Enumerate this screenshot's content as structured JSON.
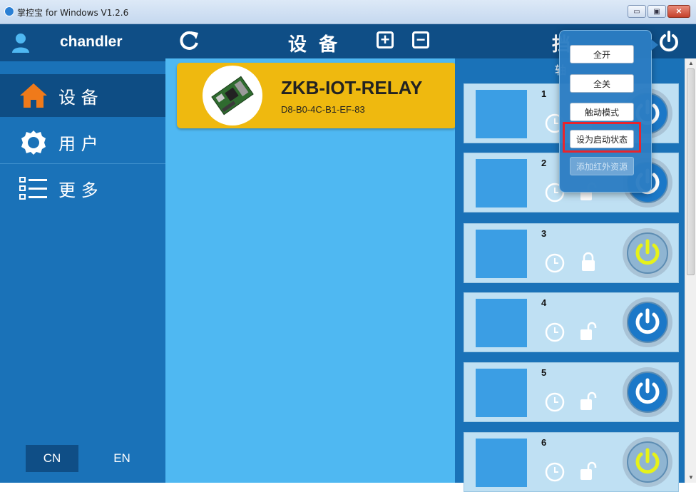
{
  "window": {
    "title": "掌控宝 for Windows V1.2.6",
    "controls": [
      "minimize",
      "maximize",
      "close"
    ],
    "close_symbol": "✕",
    "minimize_symbol": "▭",
    "maximize_symbol": "▣"
  },
  "sidebar": {
    "username": "chandler",
    "items": [
      {
        "label": "设 备",
        "icon": "home-icon",
        "active": true
      },
      {
        "label": "用 户",
        "icon": "gear-icon",
        "active": false
      },
      {
        "label": "更 多",
        "icon": "list-icon",
        "active": false
      }
    ],
    "languages": [
      {
        "label": "CN",
        "active": true
      },
      {
        "label": "EN",
        "active": false
      }
    ]
  },
  "devices": {
    "title": "设 备",
    "add_symbol": "+",
    "remove_symbol": "−",
    "list": [
      {
        "name": "ZKB-IOT-RELAY",
        "mac": "D8-B0-4C-B1-EF-83"
      }
    ]
  },
  "control": {
    "title_visible": "挡",
    "subtitle_visible": "轴",
    "relays": [
      {
        "number": "1",
        "locked": false,
        "power_on": false
      },
      {
        "number": "2",
        "locked": false,
        "power_on": false
      },
      {
        "number": "3",
        "locked": true,
        "power_on": true
      },
      {
        "number": "4",
        "locked": false,
        "power_on": false
      },
      {
        "number": "5",
        "locked": false,
        "power_on": false
      },
      {
        "number": "6",
        "locked": false,
        "power_on": true
      }
    ]
  },
  "popup_menu": {
    "items": [
      {
        "label": "全开",
        "enabled": true
      },
      {
        "label": "全关",
        "enabled": true
      },
      {
        "label": "触动模式",
        "enabled": true
      },
      {
        "label": "设为启动状态",
        "enabled": true,
        "highlighted": true
      },
      {
        "label": "添加红外资源",
        "enabled": false
      }
    ]
  },
  "colors": {
    "dark_blue": "#0f4e86",
    "mid_blue": "#1a72b8",
    "light_blue": "#4fb8f2",
    "device_card": "#efb90f",
    "relay_card": "#bfe0f3",
    "power_on": "#e6f21a",
    "highlight": "#e8242d"
  }
}
